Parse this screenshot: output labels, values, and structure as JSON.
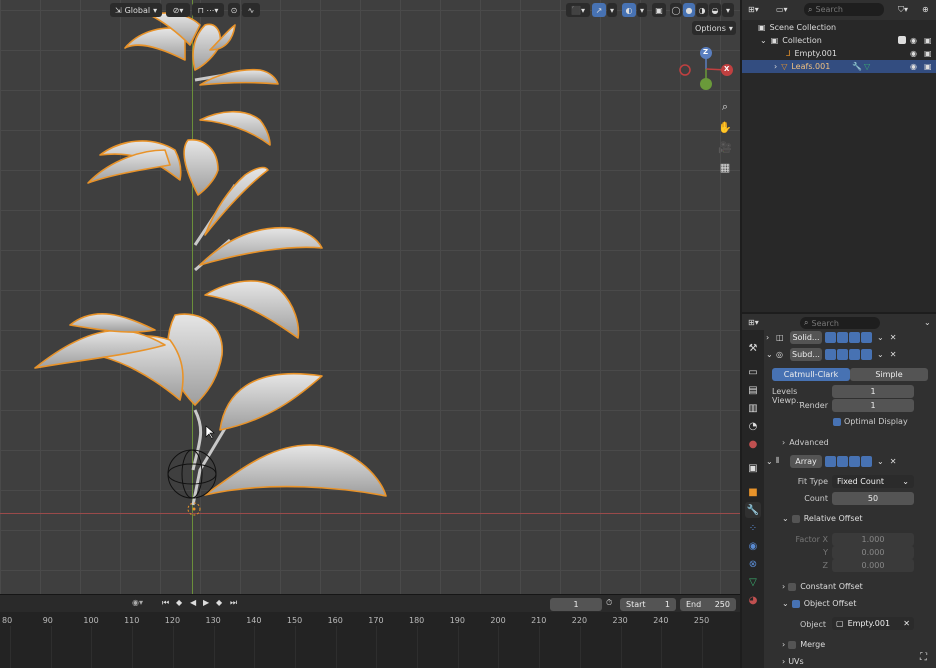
{
  "viewport": {
    "orientation": "Global",
    "options_label": "Options",
    "gizmo": {
      "z": "Z",
      "x": "X"
    }
  },
  "timeline": {
    "current_frame": "1",
    "start_label": "Start",
    "start_value": "1",
    "end_label": "End",
    "end_value": "250",
    "ruler": [
      "80",
      "90",
      "100",
      "110",
      "120",
      "130",
      "140",
      "150",
      "160",
      "170",
      "180",
      "190",
      "200",
      "210",
      "220",
      "230",
      "240",
      "250"
    ]
  },
  "outliner": {
    "search_placeholder": "Search",
    "items": [
      {
        "label": "Scene Collection"
      },
      {
        "label": "Collection"
      },
      {
        "label": "Empty.001"
      },
      {
        "label": "Leafs.001"
      }
    ]
  },
  "properties": {
    "search_placeholder": "Search",
    "modifiers": {
      "solidify": {
        "name": "Solid..."
      },
      "subdivision": {
        "name": "Subd...",
        "catmull_label": "Catmull-Clark",
        "simple_label": "Simple",
        "levels_label": "Levels Viewp...",
        "levels_value": "1",
        "render_label": "Render",
        "render_value": "1",
        "optimal_label": "Optimal Display",
        "advanced_label": "Advanced"
      },
      "array": {
        "name": "Array",
        "fit_type_label": "Fit Type",
        "fit_type_value": "Fixed Count",
        "count_label": "Count",
        "count_value": "50",
        "relative_label": "Relative Offset",
        "factor_x_label": "Factor X",
        "factor_x_value": "1.000",
        "y_label": "Y",
        "y_value": "0.000",
        "z_label": "Z",
        "z_value": "0.000",
        "constant_label": "Constant Offset",
        "object_offset_label": "Object Offset",
        "object_label": "Object",
        "object_value": "Empty.001",
        "merge_label": "Merge",
        "uvs_label": "UVs"
      }
    }
  }
}
